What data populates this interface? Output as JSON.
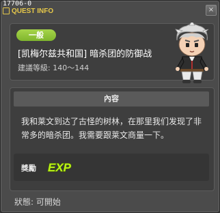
{
  "window": {
    "id_text": "17706-0",
    "title": "QUEST INFO",
    "close_glyph": "×"
  },
  "quest": {
    "category": "一般",
    "title": "[凯梅尔兹共和国] 暗杀团的防御战",
    "level_label": "建議等級: 140～144"
  },
  "contents": {
    "header": "內容",
    "description": "我和莱文到达了古怪的树林，在那里我们发现了非常多的暗杀团。我需要跟莱文商量一下。"
  },
  "reward": {
    "label": "獎勵",
    "exp_text": "EXP"
  },
  "status": {
    "text": "狀態:  可開始"
  },
  "colors": {
    "title_gold": "#e6c84a",
    "category_green": "#8cc63f",
    "exp_green": "#b9f21a"
  },
  "icons": {
    "npc": "npc-portrait-icon",
    "exp": "exp-icon"
  }
}
